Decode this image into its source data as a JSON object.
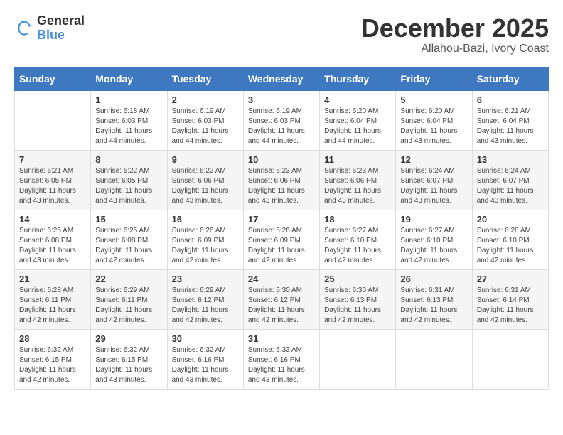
{
  "header": {
    "logo_general": "General",
    "logo_blue": "Blue",
    "month": "December 2025",
    "location": "Allahou-Bazi, Ivory Coast"
  },
  "days_of_week": [
    "Sunday",
    "Monday",
    "Tuesday",
    "Wednesday",
    "Thursday",
    "Friday",
    "Saturday"
  ],
  "weeks": [
    [
      {
        "day": "",
        "sunrise": "",
        "sunset": "",
        "daylight": ""
      },
      {
        "day": "1",
        "sunrise": "Sunrise: 6:18 AM",
        "sunset": "Sunset: 6:03 PM",
        "daylight": "Daylight: 11 hours and 44 minutes."
      },
      {
        "day": "2",
        "sunrise": "Sunrise: 6:19 AM",
        "sunset": "Sunset: 6:03 PM",
        "daylight": "Daylight: 11 hours and 44 minutes."
      },
      {
        "day": "3",
        "sunrise": "Sunrise: 6:19 AM",
        "sunset": "Sunset: 6:03 PM",
        "daylight": "Daylight: 11 hours and 44 minutes."
      },
      {
        "day": "4",
        "sunrise": "Sunrise: 6:20 AM",
        "sunset": "Sunset: 6:04 PM",
        "daylight": "Daylight: 11 hours and 44 minutes."
      },
      {
        "day": "5",
        "sunrise": "Sunrise: 6:20 AM",
        "sunset": "Sunset: 6:04 PM",
        "daylight": "Daylight: 11 hours and 43 minutes."
      },
      {
        "day": "6",
        "sunrise": "Sunrise: 6:21 AM",
        "sunset": "Sunset: 6:04 PM",
        "daylight": "Daylight: 11 hours and 43 minutes."
      }
    ],
    [
      {
        "day": "7",
        "sunrise": "Sunrise: 6:21 AM",
        "sunset": "Sunset: 6:05 PM",
        "daylight": "Daylight: 11 hours and 43 minutes."
      },
      {
        "day": "8",
        "sunrise": "Sunrise: 6:22 AM",
        "sunset": "Sunset: 6:05 PM",
        "daylight": "Daylight: 11 hours and 43 minutes."
      },
      {
        "day": "9",
        "sunrise": "Sunrise: 6:22 AM",
        "sunset": "Sunset: 6:06 PM",
        "daylight": "Daylight: 11 hours and 43 minutes."
      },
      {
        "day": "10",
        "sunrise": "Sunrise: 6:23 AM",
        "sunset": "Sunset: 6:06 PM",
        "daylight": "Daylight: 11 hours and 43 minutes."
      },
      {
        "day": "11",
        "sunrise": "Sunrise: 6:23 AM",
        "sunset": "Sunset: 6:06 PM",
        "daylight": "Daylight: 11 hours and 43 minutes."
      },
      {
        "day": "12",
        "sunrise": "Sunrise: 6:24 AM",
        "sunset": "Sunset: 6:07 PM",
        "daylight": "Daylight: 11 hours and 43 minutes."
      },
      {
        "day": "13",
        "sunrise": "Sunrise: 6:24 AM",
        "sunset": "Sunset: 6:07 PM",
        "daylight": "Daylight: 11 hours and 43 minutes."
      }
    ],
    [
      {
        "day": "14",
        "sunrise": "Sunrise: 6:25 AM",
        "sunset": "Sunset: 6:08 PM",
        "daylight": "Daylight: 11 hours and 43 minutes."
      },
      {
        "day": "15",
        "sunrise": "Sunrise: 6:25 AM",
        "sunset": "Sunset: 6:08 PM",
        "daylight": "Daylight: 11 hours and 42 minutes."
      },
      {
        "day": "16",
        "sunrise": "Sunrise: 6:26 AM",
        "sunset": "Sunset: 6:09 PM",
        "daylight": "Daylight: 11 hours and 42 minutes."
      },
      {
        "day": "17",
        "sunrise": "Sunrise: 6:26 AM",
        "sunset": "Sunset: 6:09 PM",
        "daylight": "Daylight: 11 hours and 42 minutes."
      },
      {
        "day": "18",
        "sunrise": "Sunrise: 6:27 AM",
        "sunset": "Sunset: 6:10 PM",
        "daylight": "Daylight: 11 hours and 42 minutes."
      },
      {
        "day": "19",
        "sunrise": "Sunrise: 6:27 AM",
        "sunset": "Sunset: 6:10 PM",
        "daylight": "Daylight: 11 hours and 42 minutes."
      },
      {
        "day": "20",
        "sunrise": "Sunrise: 6:28 AM",
        "sunset": "Sunset: 6:10 PM",
        "daylight": "Daylight: 11 hours and 42 minutes."
      }
    ],
    [
      {
        "day": "21",
        "sunrise": "Sunrise: 6:28 AM",
        "sunset": "Sunset: 6:11 PM",
        "daylight": "Daylight: 11 hours and 42 minutes."
      },
      {
        "day": "22",
        "sunrise": "Sunrise: 6:29 AM",
        "sunset": "Sunset: 6:11 PM",
        "daylight": "Daylight: 11 hours and 42 minutes."
      },
      {
        "day": "23",
        "sunrise": "Sunrise: 6:29 AM",
        "sunset": "Sunset: 6:12 PM",
        "daylight": "Daylight: 11 hours and 42 minutes."
      },
      {
        "day": "24",
        "sunrise": "Sunrise: 6:30 AM",
        "sunset": "Sunset: 6:12 PM",
        "daylight": "Daylight: 11 hours and 42 minutes."
      },
      {
        "day": "25",
        "sunrise": "Sunrise: 6:30 AM",
        "sunset": "Sunset: 6:13 PM",
        "daylight": "Daylight: 11 hours and 42 minutes."
      },
      {
        "day": "26",
        "sunrise": "Sunrise: 6:31 AM",
        "sunset": "Sunset: 6:13 PM",
        "daylight": "Daylight: 11 hours and 42 minutes."
      },
      {
        "day": "27",
        "sunrise": "Sunrise: 6:31 AM",
        "sunset": "Sunset: 6:14 PM",
        "daylight": "Daylight: 11 hours and 42 minutes."
      }
    ],
    [
      {
        "day": "28",
        "sunrise": "Sunrise: 6:32 AM",
        "sunset": "Sunset: 6:15 PM",
        "daylight": "Daylight: 11 hours and 42 minutes."
      },
      {
        "day": "29",
        "sunrise": "Sunrise: 6:32 AM",
        "sunset": "Sunset: 6:15 PM",
        "daylight": "Daylight: 11 hours and 43 minutes."
      },
      {
        "day": "30",
        "sunrise": "Sunrise: 6:32 AM",
        "sunset": "Sunset: 6:16 PM",
        "daylight": "Daylight: 11 hours and 43 minutes."
      },
      {
        "day": "31",
        "sunrise": "Sunrise: 6:33 AM",
        "sunset": "Sunset: 6:16 PM",
        "daylight": "Daylight: 11 hours and 43 minutes."
      },
      {
        "day": "",
        "sunrise": "",
        "sunset": "",
        "daylight": ""
      },
      {
        "day": "",
        "sunrise": "",
        "sunset": "",
        "daylight": ""
      },
      {
        "day": "",
        "sunrise": "",
        "sunset": "",
        "daylight": ""
      }
    ]
  ]
}
